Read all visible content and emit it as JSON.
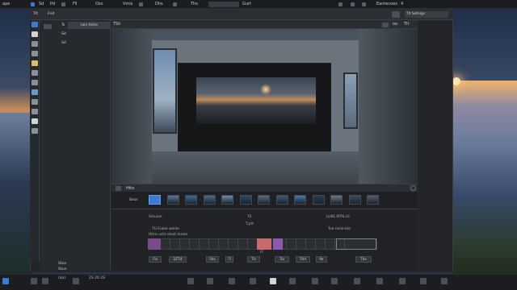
{
  "menubar": {
    "app_name": "ape",
    "items": [
      "Sd",
      "Pd",
      "Fil",
      "Oxs",
      "Vmis",
      "Dhs",
      "Ths",
      "Te"
    ],
    "title": "Gurt",
    "right_label": "Eantecoes",
    "right_num": "4"
  },
  "toolbar": {
    "tab1": "Tlt",
    "tab2": "Fnd",
    "right_field": "Tlt Setiiigs"
  },
  "panel": {
    "items": [
      {
        "a": "Ts",
        "b": "Iain fafos"
      },
      {
        "a": "Sd",
        "b": ""
      },
      {
        "a": "Sd",
        "b": ""
      }
    ],
    "bottom1": "Ston",
    "bottom2": "Stun"
  },
  "viewer": {
    "tab": "TSh",
    "controls": "oo",
    "right_label": "Tlt"
  },
  "filmstrip": {
    "label": "Snor",
    "left_tag": "Hito",
    "count": 13
  },
  "info": {
    "line1": "Smulae",
    "line2": "T0",
    "line3": "LUKE NTALLS",
    "line4": "T.ptt",
    "line5": "TU Eubie wolde",
    "line6": "Hitre ucte elvet lesele",
    "line7": "Tue nolie-bie",
    "line8": "Fl"
  },
  "bottom_chips": [
    "Fla",
    "3ZTI4",
    "Sha",
    "7l",
    "Tis",
    "Tla",
    "THA",
    "fle",
    "The"
  ],
  "taskbar": {
    "left_text": "(aa)",
    "right_text": "2S 20 2S"
  },
  "colors": {
    "accent": "#3b7bd6",
    "track_highlight": "#c76a6a",
    "track_purple": "#8a5ab0"
  }
}
